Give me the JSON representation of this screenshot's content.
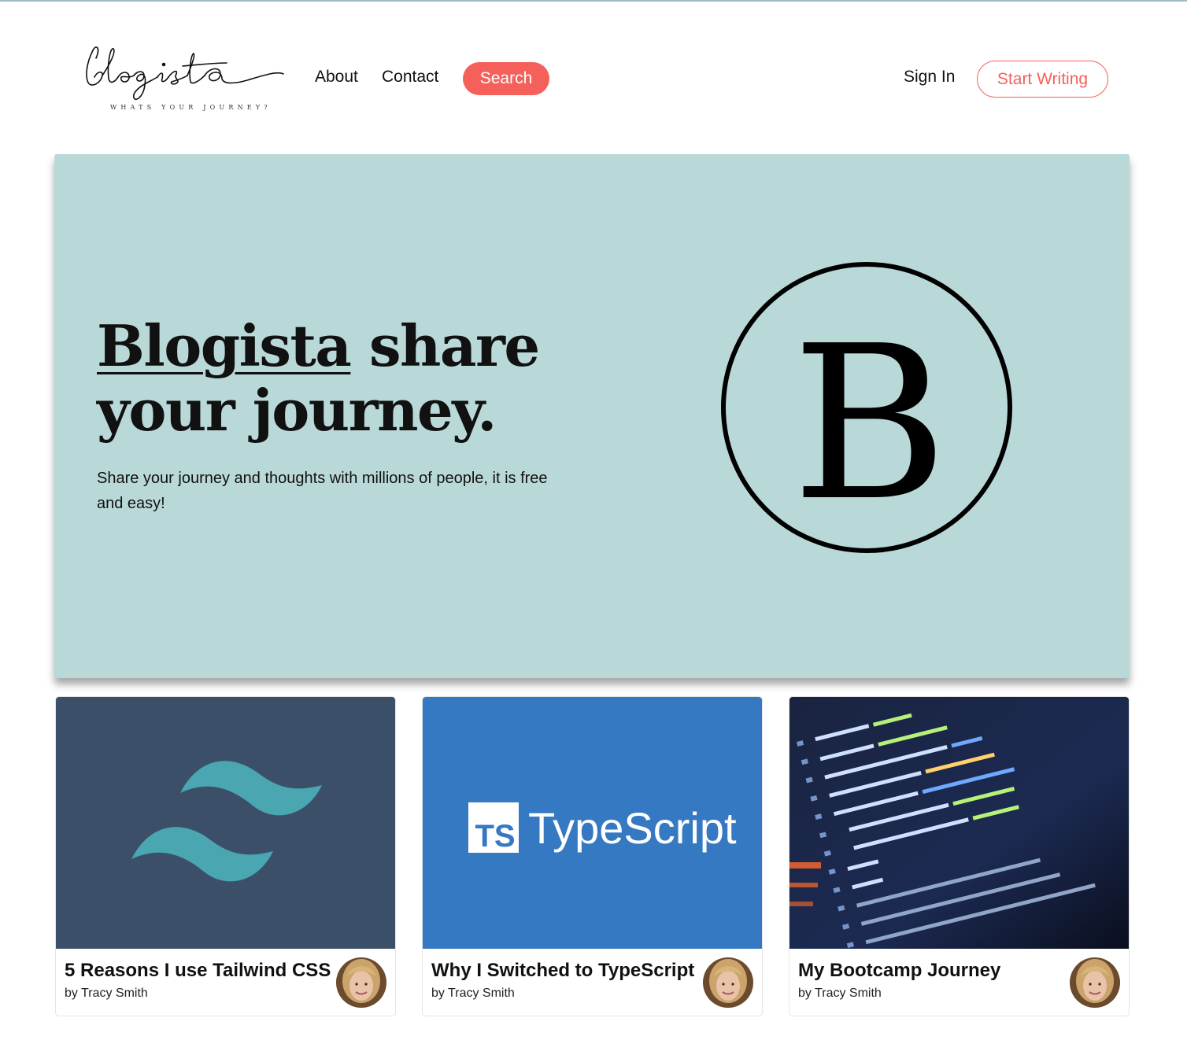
{
  "header": {
    "logo_text": "blogista",
    "logo_tagline": "WHATS YOUR JOURNEY?",
    "nav": {
      "about": "About",
      "contact": "Contact"
    },
    "search_label": "Search",
    "sign_in": "Sign In",
    "start_writing": "Start Writing"
  },
  "hero": {
    "title_brand": "Blogista",
    "title_rest": " share your journey.",
    "subtitle": "Share your journey and thoughts with millions of people, it is free and easy!",
    "emblem_letter": "B"
  },
  "colors": {
    "accent": "#f6605a",
    "hero_bg": "#b9d9d8",
    "tailwind_card_bg": "#3b5068",
    "tailwind_logo": "#4aa6b0",
    "typescript_card_bg": "#3679c3"
  },
  "posts": [
    {
      "title": "5 Reasons I use Tailwind CSS",
      "author": "by Tracy Smith",
      "image": "tailwind-logo"
    },
    {
      "title": "Why I Switched to TypeScript",
      "author": "by Tracy Smith",
      "image": "typescript-logo",
      "image_text": "TypeScript",
      "badge": "TS"
    },
    {
      "title": "My Bootcamp Journey",
      "author": "by Tracy Smith",
      "image": "code-screen"
    }
  ]
}
